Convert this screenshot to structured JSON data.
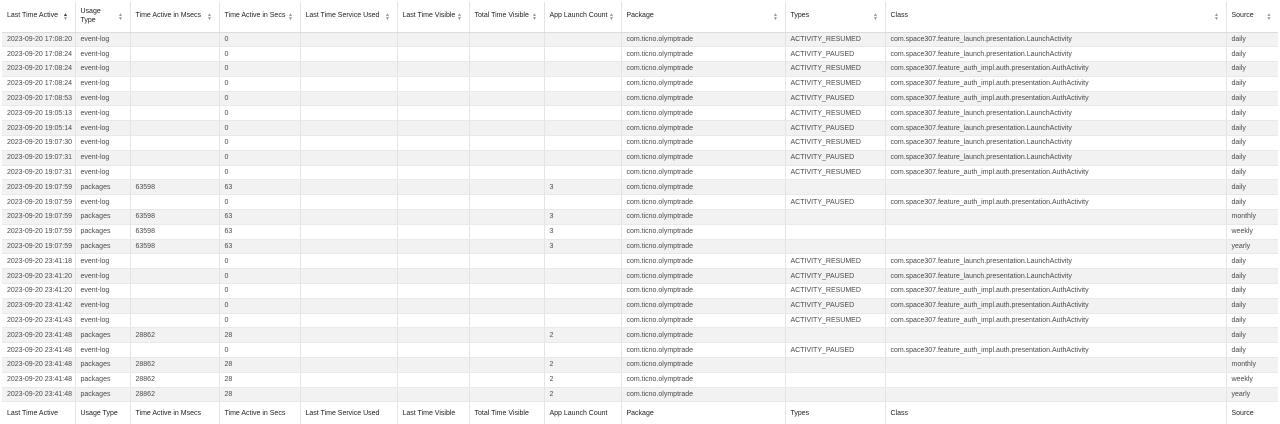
{
  "columns": [
    {
      "key": "last_time_active",
      "label": "Last Time Active",
      "sorted": "asc"
    },
    {
      "key": "usage_type",
      "label": "Usage Type"
    },
    {
      "key": "time_active_msecs",
      "label": "Time Active in Msecs"
    },
    {
      "key": "time_active_secs",
      "label": "Time Active in Secs"
    },
    {
      "key": "last_time_service_used",
      "label": "Last Time Service Used"
    },
    {
      "key": "last_time_visible",
      "label": "Last Time Visible"
    },
    {
      "key": "total_time_visible",
      "label": "Total Time Visible"
    },
    {
      "key": "app_launch_count",
      "label": "App Launch Count"
    },
    {
      "key": "package",
      "label": "Package"
    },
    {
      "key": "types",
      "label": "Types"
    },
    {
      "key": "class",
      "label": "Class"
    },
    {
      "key": "source",
      "label": "Source"
    }
  ],
  "rows": [
    [
      "2023-09-20 17:08:20",
      "event-log",
      "",
      "0",
      "",
      "",
      "",
      "",
      "com.ticno.olymptrade",
      "ACTIVITY_RESUMED",
      "com.space307.feature_launch.presentation.LaunchActivity",
      "daily"
    ],
    [
      "2023-09-20 17:08:24",
      "event-log",
      "",
      "0",
      "",
      "",
      "",
      "",
      "com.ticno.olymptrade",
      "ACTIVITY_PAUSED",
      "com.space307.feature_launch.presentation.LaunchActivity",
      "daily"
    ],
    [
      "2023-09-20 17:08:24",
      "event-log",
      "",
      "0",
      "",
      "",
      "",
      "",
      "com.ticno.olymptrade",
      "ACTIVITY_RESUMED",
      "com.space307.feature_auth_impl.auth.presentation.AuthActivity",
      "daily"
    ],
    [
      "2023-09-20 17:08:24",
      "event-log",
      "",
      "0",
      "",
      "",
      "",
      "",
      "com.ticno.olymptrade",
      "ACTIVITY_RESUMED",
      "com.space307.feature_auth_impl.auth.presentation.AuthActivity",
      "daily"
    ],
    [
      "2023-09-20 17:08:53",
      "event-log",
      "",
      "0",
      "",
      "",
      "",
      "",
      "com.ticno.olymptrade",
      "ACTIVITY_PAUSED",
      "com.space307.feature_auth_impl.auth.presentation.AuthActivity",
      "daily"
    ],
    [
      "2023-09-20 19:05:13",
      "event-log",
      "",
      "0",
      "",
      "",
      "",
      "",
      "com.ticno.olymptrade",
      "ACTIVITY_RESUMED",
      "com.space307.feature_launch.presentation.LaunchActivity",
      "daily"
    ],
    [
      "2023-09-20 19:05:14",
      "event-log",
      "",
      "0",
      "",
      "",
      "",
      "",
      "com.ticno.olymptrade",
      "ACTIVITY_PAUSED",
      "com.space307.feature_launch.presentation.LaunchActivity",
      "daily"
    ],
    [
      "2023-09-20 19:07:30",
      "event-log",
      "",
      "0",
      "",
      "",
      "",
      "",
      "com.ticno.olymptrade",
      "ACTIVITY_RESUMED",
      "com.space307.feature_launch.presentation.LaunchActivity",
      "daily"
    ],
    [
      "2023-09-20 19:07:31",
      "event-log",
      "",
      "0",
      "",
      "",
      "",
      "",
      "com.ticno.olymptrade",
      "ACTIVITY_PAUSED",
      "com.space307.feature_launch.presentation.LaunchActivity",
      "daily"
    ],
    [
      "2023-09-20 19:07:31",
      "event-log",
      "",
      "0",
      "",
      "",
      "",
      "",
      "com.ticno.olymptrade",
      "ACTIVITY_RESUMED",
      "com.space307.feature_auth_impl.auth.presentation.AuthActivity",
      "daily"
    ],
    [
      "2023-09-20 19:07:59",
      "packages",
      "63598",
      "63",
      "",
      "",
      "",
      "3",
      "com.ticno.olymptrade",
      "",
      "",
      "daily"
    ],
    [
      "2023-09-20 19:07:59",
      "event-log",
      "",
      "0",
      "",
      "",
      "",
      "",
      "com.ticno.olymptrade",
      "ACTIVITY_PAUSED",
      "com.space307.feature_auth_impl.auth.presentation.AuthActivity",
      "daily"
    ],
    [
      "2023-09-20 19:07:59",
      "packages",
      "63598",
      "63",
      "",
      "",
      "",
      "3",
      "com.ticno.olymptrade",
      "",
      "",
      "monthly"
    ],
    [
      "2023-09-20 19:07:59",
      "packages",
      "63598",
      "63",
      "",
      "",
      "",
      "3",
      "com.ticno.olymptrade",
      "",
      "",
      "weekly"
    ],
    [
      "2023-09-20 19:07:59",
      "packages",
      "63598",
      "63",
      "",
      "",
      "",
      "3",
      "com.ticno.olymptrade",
      "",
      "",
      "yearly"
    ],
    [
      "2023-09-20 23:41:18",
      "event-log",
      "",
      "0",
      "",
      "",
      "",
      "",
      "com.ticno.olymptrade",
      "ACTIVITY_RESUMED",
      "com.space307.feature_launch.presentation.LaunchActivity",
      "daily"
    ],
    [
      "2023-09-20 23:41:20",
      "event-log",
      "",
      "0",
      "",
      "",
      "",
      "",
      "com.ticno.olymptrade",
      "ACTIVITY_PAUSED",
      "com.space307.feature_launch.presentation.LaunchActivity",
      "daily"
    ],
    [
      "2023-09-20 23:41:20",
      "event-log",
      "",
      "0",
      "",
      "",
      "",
      "",
      "com.ticno.olymptrade",
      "ACTIVITY_RESUMED",
      "com.space307.feature_auth_impl.auth.presentation.AuthActivity",
      "daily"
    ],
    [
      "2023-09-20 23:41:42",
      "event-log",
      "",
      "0",
      "",
      "",
      "",
      "",
      "com.ticno.olymptrade",
      "ACTIVITY_PAUSED",
      "com.space307.feature_auth_impl.auth.presentation.AuthActivity",
      "daily"
    ],
    [
      "2023-09-20 23:41:43",
      "event-log",
      "",
      "0",
      "",
      "",
      "",
      "",
      "com.ticno.olymptrade",
      "ACTIVITY_RESUMED",
      "com.space307.feature_auth_impl.auth.presentation.AuthActivity",
      "daily"
    ],
    [
      "2023-09-20 23:41:48",
      "packages",
      "28862",
      "28",
      "",
      "",
      "",
      "2",
      "com.ticno.olymptrade",
      "",
      "",
      "daily"
    ],
    [
      "2023-09-20 23:41:48",
      "event-log",
      "",
      "0",
      "",
      "",
      "",
      "",
      "com.ticno.olymptrade",
      "ACTIVITY_PAUSED",
      "com.space307.feature_auth_impl.auth.presentation.AuthActivity",
      "daily"
    ],
    [
      "2023-09-20 23:41:48",
      "packages",
      "28862",
      "28",
      "",
      "",
      "",
      "2",
      "com.ticno.olymptrade",
      "",
      "",
      "monthly"
    ],
    [
      "2023-09-20 23:41:48",
      "packages",
      "28862",
      "28",
      "",
      "",
      "",
      "2",
      "com.ticno.olymptrade",
      "",
      "",
      "weekly"
    ],
    [
      "2023-09-20 23:41:48",
      "packages",
      "28862",
      "28",
      "",
      "",
      "",
      "2",
      "com.ticno.olymptrade",
      "",
      "",
      "yearly"
    ]
  ]
}
